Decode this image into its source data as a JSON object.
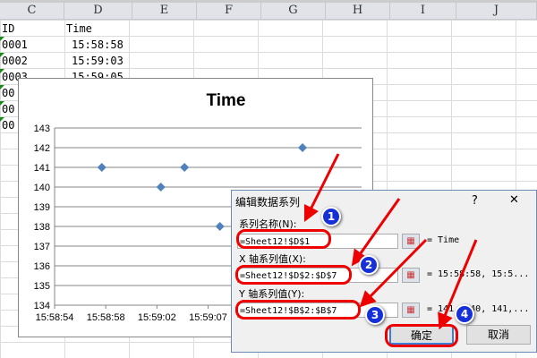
{
  "columns": [
    "C",
    "D",
    "E",
    "F",
    "G",
    "H",
    "I",
    "J"
  ],
  "sheet": {
    "headers": {
      "c": "ID",
      "d": "Time"
    },
    "rows": [
      [
        "0001",
        "15:58:58"
      ],
      [
        "0002",
        "15:59:03"
      ],
      [
        "0003",
        "15:59:05"
      ],
      [
        "00",
        ""
      ],
      [
        "00",
        ""
      ],
      [
        "00",
        ""
      ]
    ]
  },
  "chart_data": {
    "type": "scatter",
    "title": "Time",
    "xlabel": "",
    "ylabel": "",
    "x_tick_labels": [
      "15:58:54",
      "15:58:58",
      "15:59:02",
      "15:59:07"
    ],
    "x_seconds_from_start": [
      4,
      9,
      11,
      14,
      21
    ],
    "x": [
      "15:58:58",
      "15:59:03",
      "15:59:05",
      "15:59:08",
      "15:59:15"
    ],
    "y": [
      141,
      140,
      141,
      138,
      142
    ],
    "xlim_seconds": [
      0,
      26
    ],
    "ylim": [
      134,
      143
    ],
    "y_ticks": [
      134,
      135,
      136,
      137,
      138,
      139,
      140,
      141,
      142,
      143
    ],
    "grid": true,
    "marker_color": "#4f81bd"
  },
  "dialog": {
    "title": "编辑数据系列",
    "help": "?",
    "close": "✕",
    "name_label": "系列名称(N):",
    "name_value": "=Sheet12!$D$1",
    "name_result": "= Time",
    "x_label": "X 轴系列值(X):",
    "x_value": "=Sheet12!$D$2:$D$7",
    "x_result": "= 15:58:58, 15:5...",
    "y_label": "Y 轴系列值(Y):",
    "y_value": "=Sheet12!$B$2:$B$7",
    "y_result": "= 141, 140, 141,...",
    "ok": "确定",
    "cancel": "取消"
  },
  "annotations": {
    "steps": [
      "1",
      "2",
      "3",
      "4"
    ],
    "color": "#e00000"
  }
}
